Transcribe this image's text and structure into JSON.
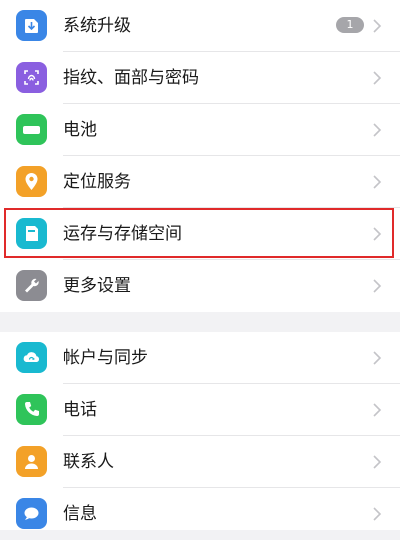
{
  "settings": {
    "items": [
      {
        "label": "系统升级",
        "icon": "system-update-icon",
        "color": "#3a86e6",
        "badge": "1"
      },
      {
        "label": "指纹、面部与密码",
        "icon": "fingerprint-icon",
        "color": "#8a5fe0"
      },
      {
        "label": "电池",
        "icon": "battery-icon",
        "color": "#2fc45a"
      },
      {
        "label": "定位服务",
        "icon": "location-icon",
        "color": "#f3a128"
      },
      {
        "label": "运存与存储空间",
        "icon": "storage-icon",
        "color": "#19b9d0"
      },
      {
        "label": "更多设置",
        "icon": "wrench-icon",
        "color": "#8c8c92"
      },
      {
        "label": "帐户与同步",
        "icon": "cloud-sync-icon",
        "color": "#19b9d0"
      },
      {
        "label": "电话",
        "icon": "phone-icon",
        "color": "#2fc45a"
      },
      {
        "label": "联系人",
        "icon": "contacts-icon",
        "color": "#f3a128"
      },
      {
        "label": "信息",
        "icon": "message-icon",
        "color": "#3a86e6"
      }
    ]
  },
  "highlight": {
    "color": "#e02a2a",
    "target": "运存与存储空间"
  }
}
